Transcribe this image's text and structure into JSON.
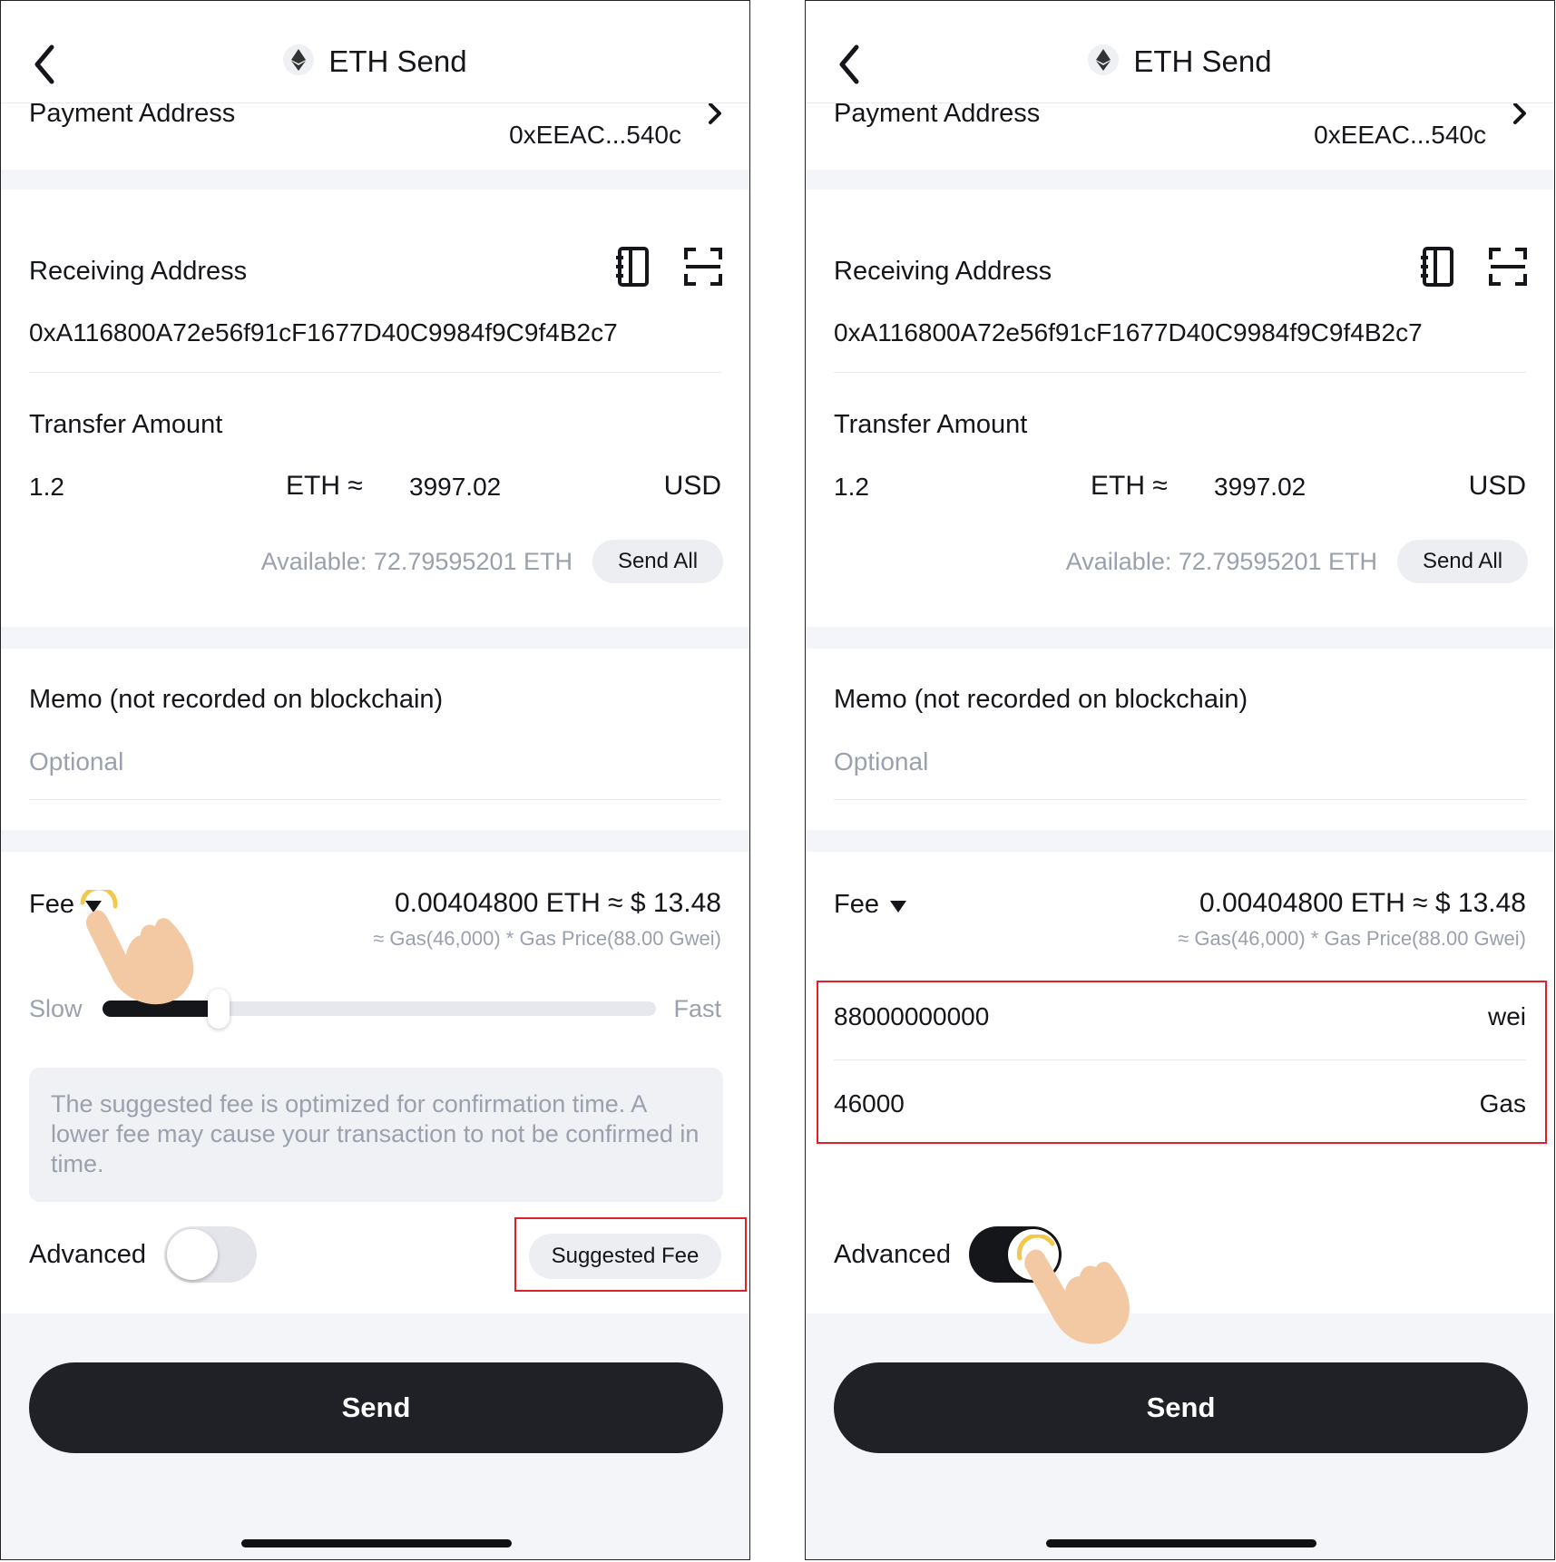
{
  "title": "ETH Send",
  "payment": {
    "label": "Payment Address",
    "value": "0xEEAC...540c"
  },
  "receiving": {
    "label": "Receiving Address",
    "value": "0xA116800A72e56f91cF1677D40C9984f9C9f4B2c7"
  },
  "transfer": {
    "label": "Transfer Amount",
    "amount": "1.2",
    "unit": "ETH ≈",
    "fiat": "3997.02",
    "fiat_unit": "USD",
    "available": "Available: 72.79595201 ETH",
    "send_all": "Send All"
  },
  "memo": {
    "label": "Memo (not recorded on blockchain)",
    "placeholder": "Optional"
  },
  "fee": {
    "label": "Fee",
    "value": "0.00404800 ETH ≈ $ 13.48",
    "detail": "≈ Gas(46,000) * Gas Price(88.00 Gwei)",
    "slow": "Slow",
    "fast": "Fast",
    "slider_level": 0.21,
    "notice": "The suggested fee is optimized for confirmation time. A lower fee may cause your transaction to not be confirmed in time.",
    "suggested_fee_button": "Suggested Fee"
  },
  "advanced": {
    "label": "Advanced",
    "left_on": false,
    "right_on": true
  },
  "advanced_fields": {
    "gas_price": "88000000000",
    "gas_price_unit": "wei",
    "gas_limit": "46000",
    "gas_limit_unit": "Gas"
  },
  "send_button": "Send",
  "colors": {
    "highlight": "#e0202a",
    "primary": "#202126",
    "muted": "#9aa0ad",
    "tap": "#f2c94c"
  },
  "icons": [
    "back-arrow-icon",
    "eth-coin-icon",
    "chevron-right-icon",
    "address-book-icon",
    "scan-icon",
    "dropdown-triangle-icon",
    "pointing-hand-icon"
  ]
}
